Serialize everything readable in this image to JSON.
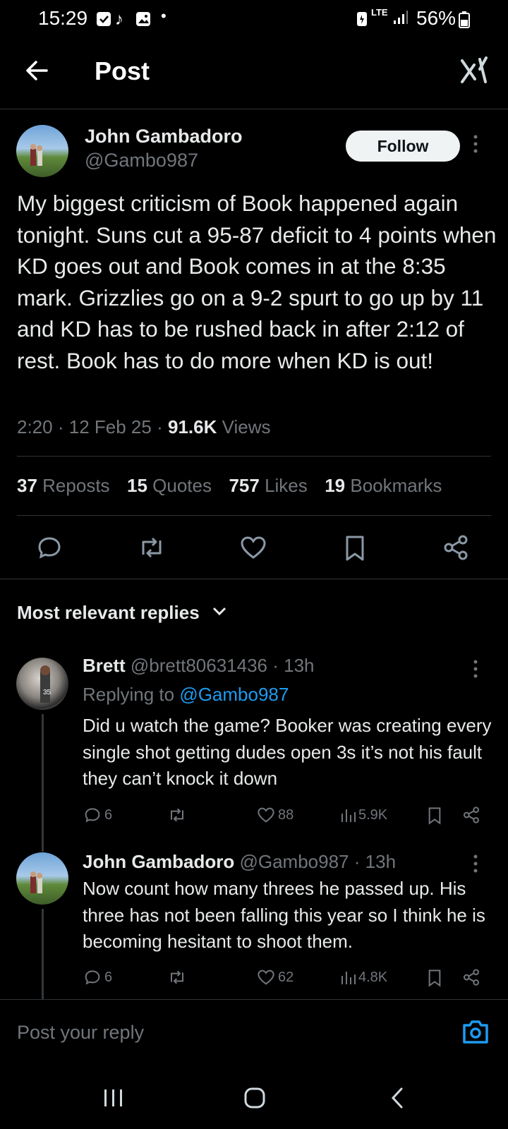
{
  "status_bar": {
    "time": "15:29",
    "network": "LTE",
    "battery": "56%"
  },
  "header": {
    "title": "Post"
  },
  "post": {
    "author_name": "John Gambadoro",
    "author_handle": "@Gambo987",
    "follow_label": "Follow",
    "text": "My biggest criticism of Book happened again tonight. Suns cut a 95-87 deficit to 4 points when KD goes out and Book comes in at the 8:35 mark. Grizzlies go on a 9-2 spurt to go up by 11 and KD has to be rushed back in after 2:12 of rest. Book has to do more when KD is out!",
    "time": "2:20",
    "date": "12 Feb 25",
    "views_count": "91.6K",
    "views_label": "Views",
    "sep": "·",
    "stats": [
      {
        "count": "37",
        "label": "Reposts"
      },
      {
        "count": "15",
        "label": "Quotes"
      },
      {
        "count": "757",
        "label": "Likes"
      },
      {
        "count": "19",
        "label": "Bookmarks"
      }
    ]
  },
  "replies_header": {
    "label": "Most relevant replies"
  },
  "replies": [
    {
      "name": "Brett",
      "handle": "@brett80631436",
      "time": "· 13h",
      "replying_prefix": "Replying to",
      "replying_to": "@Gambo987",
      "text": "Did u watch the game? Booker was creating every single shot getting dudes open 3s it’s not his fault they can’t knock it down",
      "replies": "6",
      "likes": "88",
      "views": "5.9K"
    },
    {
      "name": "John Gambadoro",
      "handle": "@Gambo987",
      "time": "· 13h",
      "text": "Now count how many threes he passed up. His three has not been falling this year so I think he is becoming hesitant to shoot them.",
      "replies": "6",
      "likes": "62",
      "views": "4.8K"
    }
  ],
  "composer": {
    "placeholder": "Post your reply"
  },
  "icons": {
    "back": "arrow-left-icon",
    "grok": "grok-icon",
    "more": "more-vertical-icon",
    "reply": "comment-icon",
    "repost": "repost-icon",
    "like": "heart-icon",
    "bookmark": "bookmark-icon",
    "share": "share-icon",
    "views": "bar-chart-icon",
    "camera": "camera-icon"
  },
  "colors": {
    "accent": "#1d9bf0",
    "muted": "#71767b",
    "text": "#e7e9ea",
    "background": "#000000"
  }
}
